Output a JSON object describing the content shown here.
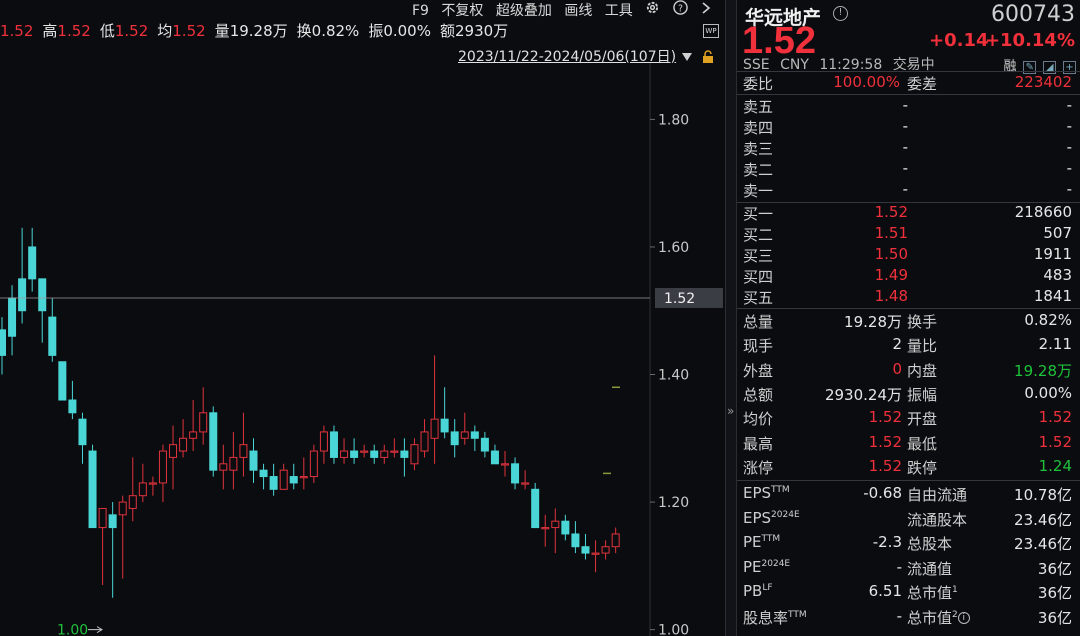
{
  "stats_bar": [
    {
      "label": "",
      "value": "1.52",
      "color": "#f0303a"
    },
    {
      "label": "高",
      "value": "1.52",
      "color": "#f0303a"
    },
    {
      "label": "低",
      "value": "1.52",
      "color": "#f0303a"
    },
    {
      "label": "均",
      "value": "1.52",
      "color": "#f0303a"
    },
    {
      "label": "量",
      "value": "19.28万",
      "color": "#e6e6e6"
    },
    {
      "label": "换",
      "value": "0.82%",
      "color": "#e6e6e6"
    },
    {
      "label": "振",
      "value": "0.00%",
      "color": "#e6e6e6"
    },
    {
      "label": "额",
      "value": "2930万",
      "color": "#e6e6e6"
    }
  ],
  "toolbar": {
    "f9": "F9",
    "fuquan": "不复权",
    "overlay": "超级叠加",
    "draw": "画线",
    "tools": "工具",
    "settings_icon": "gear-icon",
    "help_icon": "help-icon",
    "next_icon": "chevron-right-icon",
    "wp_badge": "WP"
  },
  "range": {
    "text": "2023/11/22-2024/05/06(107日)",
    "dropdown_icon": "triangle-down-icon",
    "lock_icon": "lock-icon"
  },
  "chart_data": {
    "type": "candlestick",
    "ylim": [
      0.99,
      1.89
    ],
    "y_ticks": [
      "1.80",
      "1.60",
      "1.40",
      "1.20",
      "1.00"
    ],
    "current_price_label": "1.52",
    "current_price": 1.52,
    "low_marker_label": "1.00",
    "up_color": "#e0333d",
    "down_color": "#4ad6d6",
    "candles": [
      [
        1.47,
        1.43,
        1.49,
        1.4
      ],
      [
        1.52,
        1.46,
        1.54,
        1.43
      ],
      [
        1.55,
        1.5,
        1.63,
        1.48
      ],
      [
        1.6,
        1.55,
        1.63,
        1.53
      ],
      [
        1.55,
        1.5,
        1.55,
        1.45
      ],
      [
        1.49,
        1.43,
        1.52,
        1.42
      ],
      [
        1.42,
        1.36,
        1.42,
        1.38
      ],
      [
        1.36,
        1.34,
        1.39,
        1.33
      ],
      [
        1.33,
        1.29,
        1.34,
        1.26
      ],
      [
        1.28,
        1.16,
        1.29,
        1.16
      ],
      [
        1.16,
        1.19,
        1.19,
        1.07
      ],
      [
        1.18,
        1.16,
        1.2,
        1.05
      ],
      [
        1.18,
        1.2,
        1.21,
        1.08
      ],
      [
        1.19,
        1.21,
        1.27,
        1.17
      ],
      [
        1.21,
        1.23,
        1.26,
        1.2
      ],
      [
        1.23,
        1.23,
        1.24,
        1.21
      ],
      [
        1.23,
        1.28,
        1.29,
        1.2
      ],
      [
        1.27,
        1.29,
        1.32,
        1.22
      ],
      [
        1.28,
        1.3,
        1.33,
        1.27
      ],
      [
        1.3,
        1.31,
        1.36,
        1.28
      ],
      [
        1.31,
        1.34,
        1.38,
        1.29
      ],
      [
        1.34,
        1.25,
        1.35,
        1.24
      ],
      [
        1.25,
        1.26,
        1.29,
        1.22
      ],
      [
        1.25,
        1.27,
        1.31,
        1.22
      ],
      [
        1.27,
        1.29,
        1.34,
        1.24
      ],
      [
        1.28,
        1.25,
        1.3,
        1.23
      ],
      [
        1.25,
        1.24,
        1.26,
        1.22
      ],
      [
        1.24,
        1.22,
        1.26,
        1.21
      ],
      [
        1.22,
        1.25,
        1.26,
        1.22
      ],
      [
        1.24,
        1.23,
        1.26,
        1.22
      ],
      [
        1.24,
        1.24,
        1.27,
        1.22
      ],
      [
        1.24,
        1.28,
        1.29,
        1.23
      ],
      [
        1.28,
        1.31,
        1.32,
        1.26
      ],
      [
        1.31,
        1.27,
        1.32,
        1.26
      ],
      [
        1.27,
        1.28,
        1.3,
        1.26
      ],
      [
        1.28,
        1.27,
        1.3,
        1.26
      ],
      [
        1.28,
        1.28,
        1.29,
        1.27
      ],
      [
        1.28,
        1.27,
        1.29,
        1.26
      ],
      [
        1.27,
        1.28,
        1.29,
        1.26
      ],
      [
        1.28,
        1.28,
        1.3,
        1.27
      ],
      [
        1.28,
        1.27,
        1.3,
        1.24
      ],
      [
        1.26,
        1.29,
        1.3,
        1.25
      ],
      [
        1.28,
        1.31,
        1.33,
        1.27
      ],
      [
        1.3,
        1.33,
        1.43,
        1.26
      ],
      [
        1.33,
        1.31,
        1.38,
        1.3
      ],
      [
        1.31,
        1.29,
        1.33,
        1.27
      ],
      [
        1.3,
        1.31,
        1.34,
        1.29
      ],
      [
        1.31,
        1.3,
        1.32,
        1.28
      ],
      [
        1.3,
        1.28,
        1.31,
        1.27
      ],
      [
        1.28,
        1.26,
        1.29,
        1.26
      ],
      [
        1.26,
        1.26,
        1.28,
        1.24
      ],
      [
        1.26,
        1.23,
        1.27,
        1.22
      ],
      [
        1.23,
        1.23,
        1.25,
        1.22
      ],
      [
        1.22,
        1.16,
        1.23,
        1.16
      ],
      [
        1.16,
        1.16,
        1.18,
        1.13
      ],
      [
        1.16,
        1.17,
        1.19,
        1.12
      ],
      [
        1.17,
        1.15,
        1.18,
        1.14
      ],
      [
        1.15,
        1.13,
        1.17,
        1.12
      ],
      [
        1.13,
        1.12,
        1.15,
        1.11
      ],
      [
        1.12,
        1.12,
        1.14,
        1.09
      ],
      [
        1.12,
        1.13,
        1.14,
        1.11
      ],
      [
        1.13,
        1.15,
        1.16,
        1.12
      ]
    ],
    "markers": [
      1.38,
      1.245
    ]
  },
  "quote": {
    "name": "华远地产",
    "info_icon": "info-icon",
    "code": "600743",
    "price": "1.52",
    "change": "+0.14",
    "change_pct": "+10.14%",
    "exchange": "SSE",
    "currency": "CNY",
    "time": "11:29:58",
    "status": "交易中",
    "margin_tag": "融",
    "weibi_label": "委比",
    "weibi_value": "100.00%",
    "weicha_label": "委差",
    "weicha_value": "223402",
    "sell": [
      {
        "label": "卖五",
        "price": "-",
        "vol": "-"
      },
      {
        "label": "卖四",
        "price": "-",
        "vol": "-"
      },
      {
        "label": "卖三",
        "price": "-",
        "vol": "-"
      },
      {
        "label": "卖二",
        "price": "-",
        "vol": "-"
      },
      {
        "label": "卖一",
        "price": "-",
        "vol": "-"
      }
    ],
    "buy": [
      {
        "label": "买一",
        "price": "1.52",
        "vol": "218660"
      },
      {
        "label": "买二",
        "price": "1.51",
        "vol": "507"
      },
      {
        "label": "买三",
        "price": "1.50",
        "vol": "1911"
      },
      {
        "label": "买四",
        "price": "1.49",
        "vol": "483"
      },
      {
        "label": "买五",
        "price": "1.48",
        "vol": "1841"
      }
    ],
    "stats": [
      {
        "l1": "总量",
        "v1": "19.28万",
        "c1": "#e6e6e6",
        "l2": "换手",
        "v2": "0.82%",
        "c2": "#e6e6e6"
      },
      {
        "l1": "现手",
        "v1": "2",
        "c1": "#e6e6e6",
        "l2": "量比",
        "v2": "2.11",
        "c2": "#e6e6e6"
      },
      {
        "l1": "外盘",
        "v1": "0",
        "c1": "#f0303a",
        "l2": "内盘",
        "v2": "19.28万",
        "c2": "#1fc23b"
      },
      {
        "l1": "总额",
        "v1": "2930.24万",
        "c1": "#e6e6e6",
        "l2": "振幅",
        "v2": "0.00%",
        "c2": "#e6e6e6"
      },
      {
        "l1": "均价",
        "v1": "1.52",
        "c1": "#f0303a",
        "l2": "开盘",
        "v2": "1.52",
        "c2": "#f0303a"
      },
      {
        "l1": "最高",
        "v1": "1.52",
        "c1": "#f0303a",
        "l2": "最低",
        "v2": "1.52",
        "c2": "#f0303a"
      },
      {
        "l1": "涨停",
        "v1": "1.52",
        "c1": "#f0303a",
        "l2": "跌停",
        "v2": "1.24",
        "c2": "#1fc23b"
      }
    ],
    "fundamentals": [
      {
        "l1": "EPS",
        "s1": "TTM",
        "v1": "-0.68",
        "l2": "自由流通",
        "s2": "",
        "v2": "10.78亿"
      },
      {
        "l1": "EPS",
        "s1": "2024E",
        "v1": "",
        "l2": "流通股本",
        "s2": "",
        "v2": "23.46亿"
      },
      {
        "l1": "PE",
        "s1": "TTM",
        "v1": "-2.3",
        "l2": "总股本",
        "s2": "",
        "v2": "23.46亿"
      },
      {
        "l1": "PE",
        "s1": "2024E",
        "v1": "-",
        "l2": "流通值",
        "s2": "",
        "v2": "36亿"
      },
      {
        "l1": "PB",
        "s1": "LF",
        "v1": "6.51",
        "l2": "总市值",
        "s2": "1",
        "v2": "36亿"
      },
      {
        "l1": "股息率",
        "s1": "TTM",
        "v1": "-",
        "l2": "总市值",
        "s2": "2",
        "v2": "36亿"
      }
    ]
  }
}
